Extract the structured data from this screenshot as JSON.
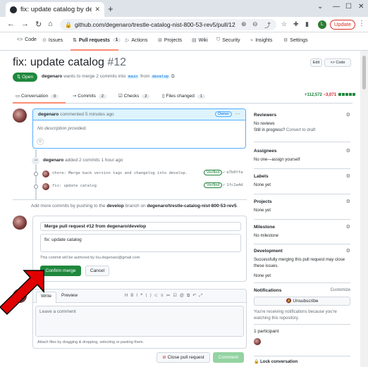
{
  "browser": {
    "tab_title": "fix: update catalog by degenaro",
    "url": "github.com/degenaro/trestle-catalog-nist-800-53-rev5/pull/12",
    "profile_initial": "L",
    "update_label": "Update"
  },
  "repo_nav": {
    "items": [
      {
        "label": "Code"
      },
      {
        "label": "Issues"
      },
      {
        "label": "Pull requests",
        "count": "1"
      },
      {
        "label": "Actions"
      },
      {
        "label": "Projects"
      },
      {
        "label": "Wiki"
      },
      {
        "label": "Security"
      },
      {
        "label": "Insights"
      },
      {
        "label": "Settings"
      }
    ]
  },
  "pr": {
    "title": "fix: update catalog",
    "number": "#12",
    "edit_label": "Edit",
    "code_label": "<> Code",
    "state": "Open",
    "author": "degenaro",
    "meta_mid": "wants to merge 2 commits into",
    "base_branch": "main",
    "meta_from": "from",
    "head_branch": "develop"
  },
  "tabs": [
    {
      "label": "Conversation",
      "count": "0"
    },
    {
      "label": "Commits",
      "count": "2"
    },
    {
      "label": "Checks",
      "count": "2"
    },
    {
      "label": "Files changed",
      "count": "1"
    }
  ],
  "diffstat": {
    "additions": "+112,572",
    "deletions": "−3,071"
  },
  "comment": {
    "author": "degenaro",
    "action": "commented 5 minutes ago",
    "badge": "Owner",
    "body": "No description provided."
  },
  "commit_event": {
    "author": "degenaro",
    "text": "added 2 commits 1 hour ago"
  },
  "commits": [
    {
      "message": "chore: Merge back version tags and changelog into develop.",
      "verified": "Verified",
      "sha": "e7b0ffa"
    },
    {
      "message": "fix: update catalog",
      "verified": "Verified",
      "sha": "1fc2a4d"
    }
  ],
  "push_note": {
    "prefix": "Add more commits by pushing to the",
    "branch": "develop",
    "mid": "branch on",
    "repo": "degenaro/trestle-catalog-nist-800-53-rev5",
    "suffix": "."
  },
  "merge": {
    "title_value": "Merge pull request #12 from degenaro/develop",
    "body_value": "fix: update catalog",
    "author_note": "This commit will be authored by lou.degenaro@gmail.com",
    "confirm_label": "Confirm merge",
    "cancel_label": "Cancel"
  },
  "new_comment": {
    "write_tab": "Write",
    "preview_tab": "Preview",
    "placeholder": "Leave a comment",
    "attach_note": "Attach files by dragging & dropping, selecting or pasting them.",
    "close_label": "Close pull request",
    "comment_label": "Comment"
  },
  "sidebar": {
    "reviewers": {
      "title": "Reviewers",
      "line1": "No reviews",
      "line2_prefix": "Still in progress?",
      "line2_link": "Convert to draft"
    },
    "assignees": {
      "title": "Assignees",
      "text": "No one—assign yourself"
    },
    "labels": {
      "title": "Labels",
      "text": "None yet"
    },
    "projects": {
      "title": "Projects",
      "text": "None yet"
    },
    "milestone": {
      "title": "Milestone",
      "text": "No milestone"
    },
    "development": {
      "title": "Development",
      "text": "Successfully merging this pull request may close these issues.",
      "text2": "None yet"
    },
    "notifications": {
      "title": "Notifications",
      "customize": "Customize",
      "button": "Unsubscribe",
      "note": "You're receiving notifications because you're watching this repository."
    },
    "participants": {
      "title": "1 participant"
    },
    "lock": {
      "label": "Lock conversation"
    }
  },
  "colors": {
    "merge_green": "#1f883d",
    "arrow_red": "#e00000",
    "accent_blue": "#0969da"
  }
}
